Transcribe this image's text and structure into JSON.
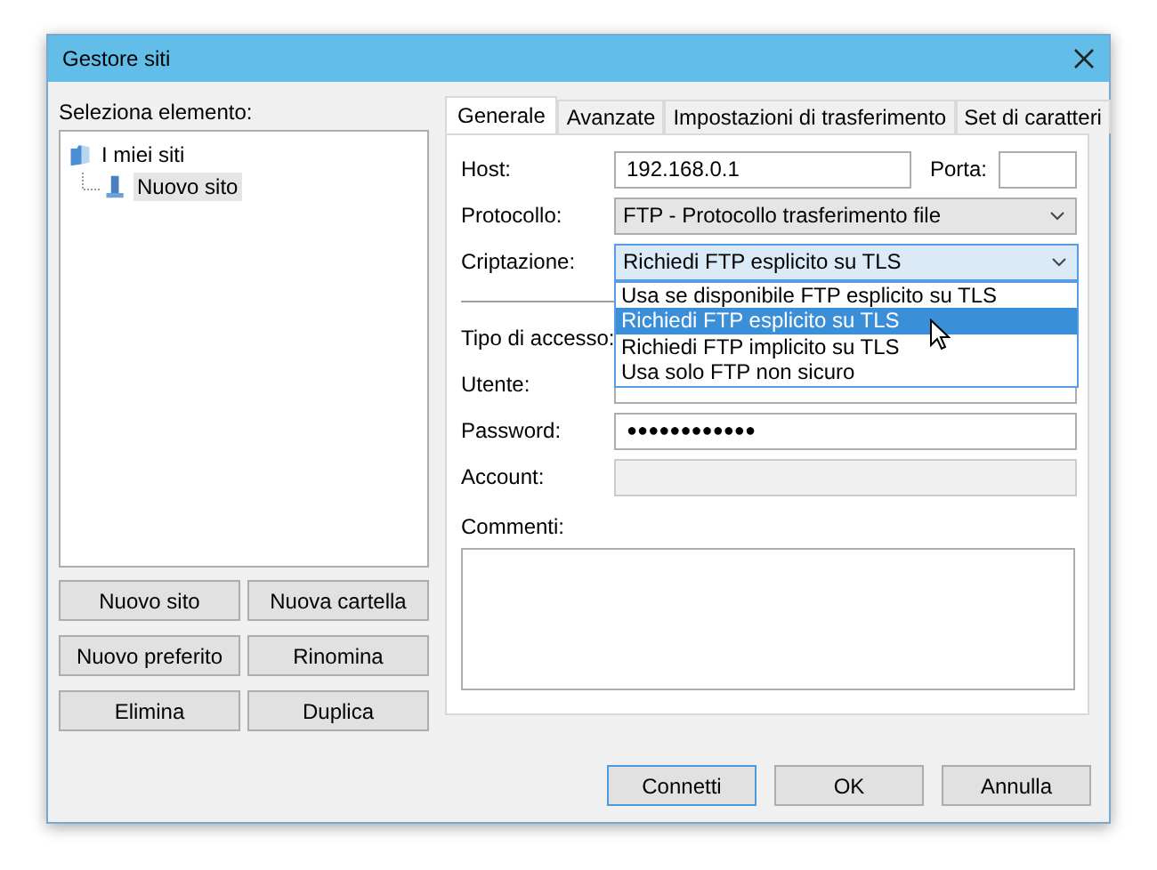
{
  "window": {
    "title": "Gestore siti"
  },
  "site_list": {
    "label": "Seleziona elemento:",
    "tree": [
      {
        "label": "I miei siti",
        "kind": "folder",
        "selected": false,
        "children": [
          {
            "label": "Nuovo sito",
            "kind": "site",
            "selected": true
          }
        ]
      }
    ]
  },
  "site_buttons": [
    "Nuovo sito",
    "Nuova cartella",
    "Nuovo preferito",
    "Rinomina",
    "Elimina",
    "Duplica"
  ],
  "tabs": [
    {
      "label": "Generale",
      "selected": true
    },
    {
      "label": "Avanzate",
      "selected": false
    },
    {
      "label": "Impostazioni di trasferimento",
      "selected": false
    },
    {
      "label": "Set di caratteri",
      "selected": false
    }
  ],
  "host": {
    "label": "Host:",
    "value": "192.168.0.1"
  },
  "port": {
    "label": "Porta:"
  },
  "protocol": {
    "label": "Protocollo:",
    "value": "FTP - Protocollo trasferimento file"
  },
  "encryption": {
    "label": "Criptazione:",
    "value": "Richiedi FTP esplicito su TLS",
    "expanded": true,
    "options": [
      {
        "label": "Usa se disponibile FTP esplicito su TLS",
        "selected": false
      },
      {
        "label": "Richiedi FTP esplicito su TLS",
        "selected": true
      },
      {
        "label": "Richiedi FTP implicito su TLS",
        "selected": false
      },
      {
        "label": "Usa solo FTP non sicuro",
        "selected": false
      }
    ]
  },
  "logon_type": {
    "label": "Tipo di accesso:"
  },
  "user": {
    "label": "Utente:"
  },
  "password": {
    "label": "Password:",
    "value": "●●●●●●●●●●●●"
  },
  "account": {
    "label": "Account:",
    "disabled": true
  },
  "comments": {
    "label": "Commenti:"
  },
  "dialog_buttons": [
    {
      "label": "Connetti",
      "default": true
    },
    {
      "label": "OK",
      "default": false
    },
    {
      "label": "Annulla",
      "default": false
    }
  ]
}
